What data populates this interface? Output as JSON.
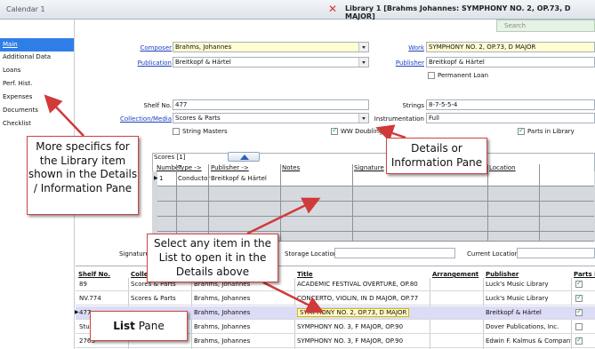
{
  "window": {
    "left_tab": "Calendar 1",
    "right_title": "Library 1 [Brahms Johannes: SYMPHONY NO. 2, OP.73, D MAJOR]",
    "close_icon": "close-icon",
    "search_placeholder": "Search"
  },
  "sidebar": {
    "items": [
      {
        "label": "Main",
        "active": true
      },
      {
        "label": "Additional Data"
      },
      {
        "label": "Loans"
      },
      {
        "label": "Perf. Hist."
      },
      {
        "label": "Expenses"
      },
      {
        "label": "Documents"
      },
      {
        "label": "Checklist"
      }
    ]
  },
  "details": {
    "composer_label": "Composer",
    "composer_value": "Brahms, Johannes",
    "work_label": "Work",
    "work_value": "SYMPHONY NO. 2, OP.73, D MAJOR",
    "publication_label": "Publication",
    "publication_value": "Breitkopf & Härtel",
    "publisher_label": "Publisher",
    "publisher_value": "Breitkopf & Härtel",
    "permanent_loan_label": "Permanent Loan",
    "shelf_label": "Shelf No.",
    "shelf_value": "477",
    "strings_label": "Strings",
    "strings_value": "8-7-5-5-4",
    "collection_label": "Collection/Media",
    "collection_value": "Scores & Parts",
    "instrumentation_label": "Instrumentation",
    "instrumentation_value": "Full",
    "string_masters_label": "String Masters",
    "ww_doubling_label": "WW Doubling",
    "parts_in_library_label": "Parts in Library"
  },
  "scores": {
    "title": "Scores [1]",
    "headers": [
      "Number",
      "Type ->",
      "Publisher ->",
      "Notes",
      "Signature",
      "Location"
    ],
    "rows": [
      {
        "number": "1",
        "type": "Conductor",
        "publisher": "Breitkopf & Härtel"
      }
    ]
  },
  "bottom_fields": {
    "signature_label": "Signature",
    "storage_label": "Storage Location",
    "current_label": "Current Location"
  },
  "list": {
    "headers": [
      "Shelf No.",
      "Collec",
      "",
      "Title",
      "Arrangement",
      "Publisher",
      "Parts i"
    ],
    "rows": [
      {
        "shelf": "89",
        "collection": "Scores & Parts",
        "composer": "Brahms, Johannes",
        "title": "ACADEMIC FESTIVAL OVERTURE, OP.80",
        "publisher": "Luck's Music Library",
        "parts": true
      },
      {
        "shelf": "NV.774",
        "collection": "Scores & Parts",
        "composer": "Brahms, Johannes",
        "title": "CONCERTO, VIOLIN, IN D MAJOR, OP.77",
        "publisher": "Luck's Music Library",
        "parts": true
      },
      {
        "shelf": "477",
        "collection": "",
        "composer": "Brahms, Johannes",
        "title": "SYMPHONY NO. 2, OP.73, D MAJOR",
        "publisher": "Breitkopf & Härtel",
        "parts": true,
        "selected": true
      },
      {
        "shelf": "Study",
        "collection": "",
        "composer": "Brahms, Johannes",
        "title": "SYMPHONY NO. 3, F MAJOR, OP.90",
        "publisher": "Dover Publications, Inc.",
        "parts": false
      },
      {
        "shelf": "276S",
        "collection": "",
        "composer": "Brahms, Johannes",
        "title": "SYMPHONY NO. 3, F MAJOR, OP.90",
        "publisher": "Edwin F. Kalmus & Company, Inc",
        "parts": true
      }
    ]
  },
  "callouts": {
    "more_specifics": "More specifics for the Library item shown in the Details / Information Pane",
    "details_pane": "Details or Information Pane",
    "select_item": "Select any item in the List to open it in the Details above",
    "list_pane_bold": "List",
    "list_pane_rest": " Pane"
  },
  "colors": {
    "accent": "#2f7ee8",
    "callout_border": "#d04545",
    "arrow": "#d03a3a",
    "selected_row": "#dcdcf7"
  }
}
